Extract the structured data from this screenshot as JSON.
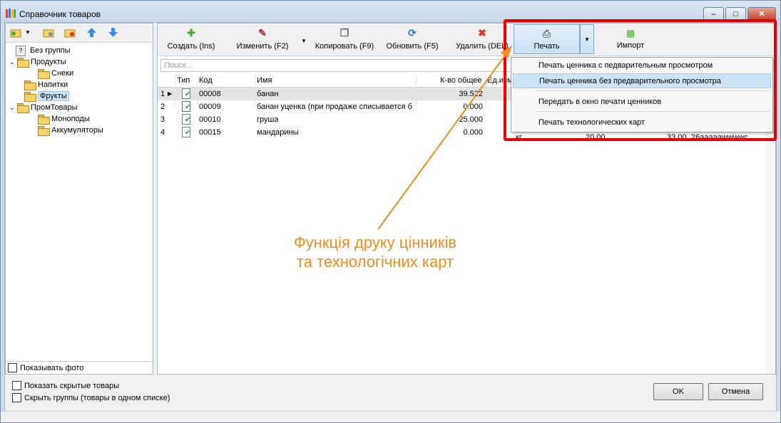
{
  "window": {
    "title": "Справочник товаров",
    "minimize": "‒",
    "maximize": "□",
    "close": "✕"
  },
  "left_toolbar": {
    "icons": [
      "add-folder-icon",
      "add-subfolder-icon",
      "delete-folder-icon",
      "move-up-icon",
      "move-down-icon"
    ]
  },
  "tree": [
    {
      "label": "Без группы",
      "level": 0
    },
    {
      "label": "Продукты",
      "level": 0
    },
    {
      "label": "Снеки",
      "level": 1
    },
    {
      "label": "Напитки",
      "level": 0
    },
    {
      "label": "Фрукты",
      "level": 0
    },
    {
      "label": "ПромТовары",
      "level": 0
    },
    {
      "label": "Моноподы",
      "level": 1
    },
    {
      "label": "Аккумуляторы",
      "level": 1
    }
  ],
  "show_photo": "Показывать фото",
  "toolbar": {
    "create": "Создать (Ins)",
    "edit": "Изменить (F2)",
    "copy": "Копировать (F9)",
    "refresh": "Обновить (F5)",
    "delete": "Удалить (DEL)",
    "print": "Печать",
    "import": "Импорт"
  },
  "search": {
    "placeholder": "Поиск..."
  },
  "grid": {
    "headers": {
      "type": "Тип",
      "code": "Код",
      "name": "Имя",
      "qty": "К-во общее",
      "unit": "Ед.изм."
    },
    "rows": [
      {
        "n": "1",
        "code": "00008",
        "name": "банан",
        "qty": "39.522"
      },
      {
        "n": "2",
        "code": "00009",
        "name": "банан уценка (при продаже списывается б",
        "qty": "0.000"
      },
      {
        "n": "3",
        "code": "00010",
        "name": "груша",
        "qty": "25.000"
      },
      {
        "n": "4",
        "code": "00015",
        "name": "мандарины",
        "qty": "0.000"
      }
    ],
    "partial_row4": {
      "unit": "кг",
      "price1": "20.00",
      "price2": "33.00",
      "extra": "26aaaaawwwwc"
    }
  },
  "print_menu": {
    "items": [
      "Печать ценника с педварительным просмотром",
      "Печать ценника без предварительного просмотра",
      "Передать в окно печати ценников",
      "Печать технологических карт"
    ]
  },
  "bottom": {
    "show_hidden": "Показать скрытые товары",
    "hide_groups": "Скрыть группы (товары в одном списке)",
    "ok": "OK",
    "cancel": "Отмена"
  },
  "annotation": {
    "line1": "Функція друку цінників",
    "line2": "та технологічних карт"
  },
  "colors": {
    "annotation": "#f28c1c",
    "highlight_frame": "#e60000",
    "selection": "#cce4f7"
  }
}
